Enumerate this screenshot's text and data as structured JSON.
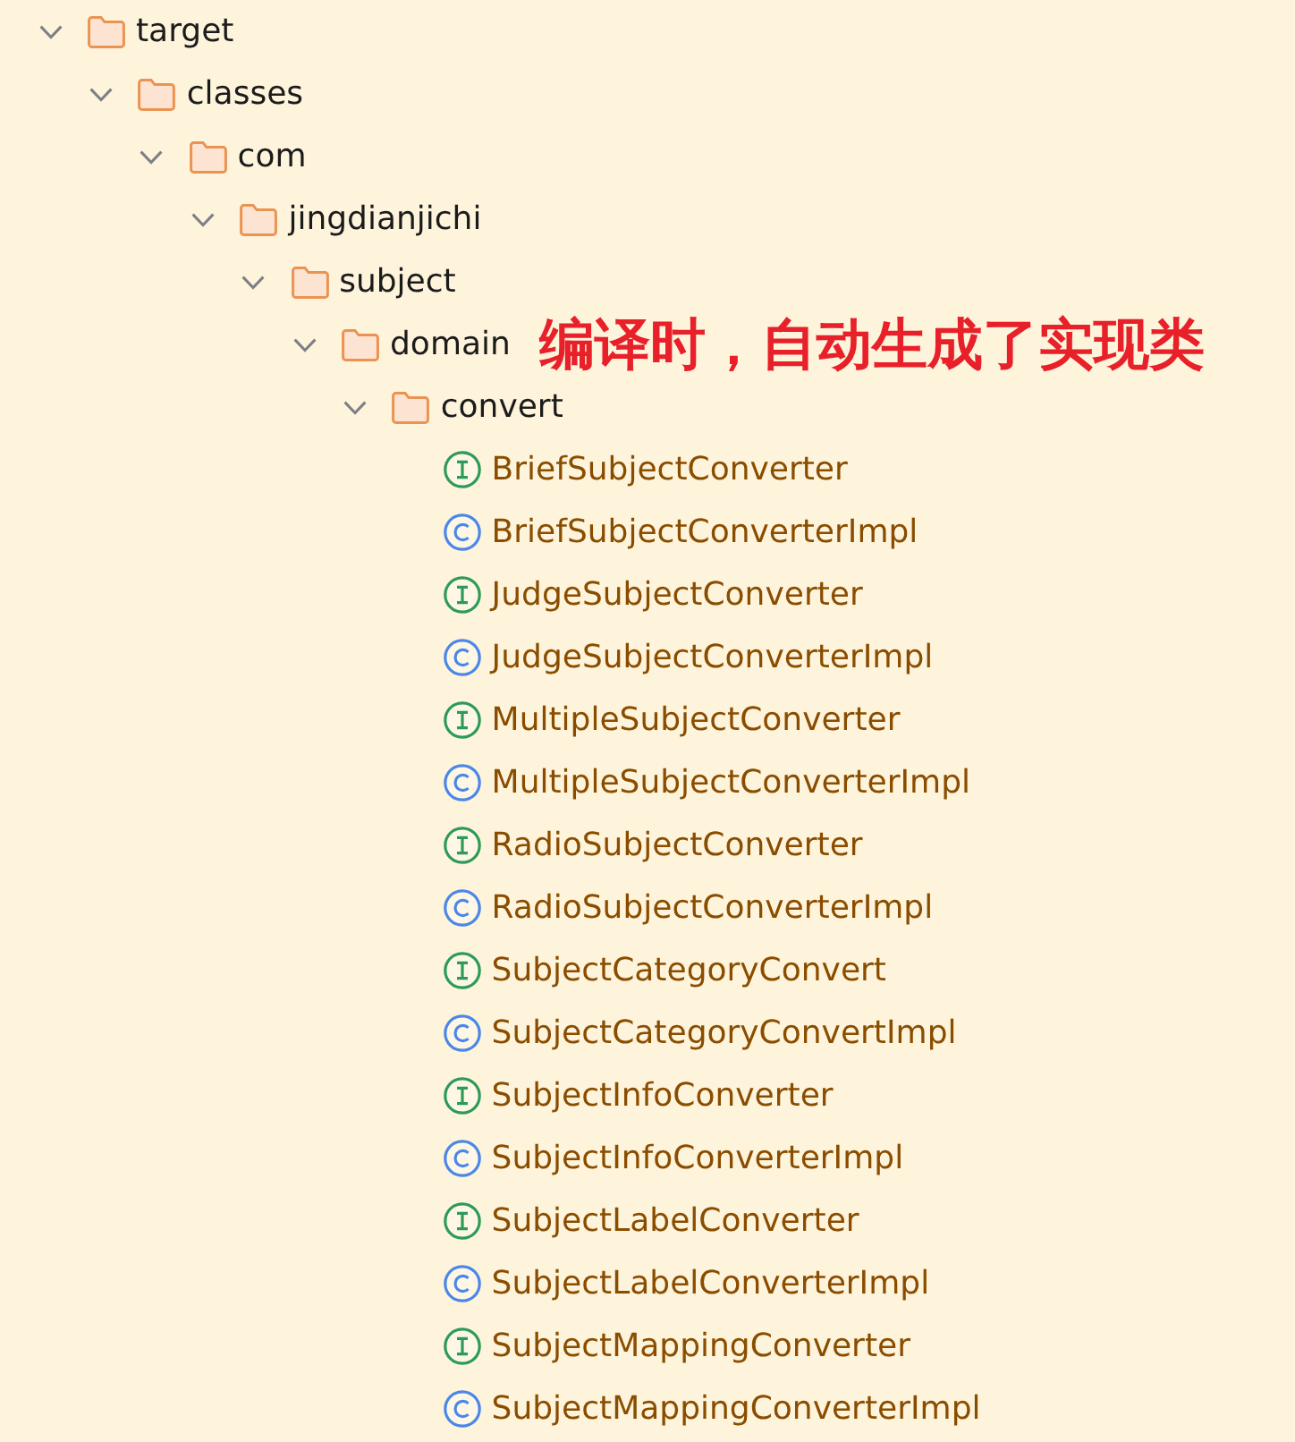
{
  "tree": [
    {
      "kind": "folder",
      "name": "target",
      "expanded": true,
      "children": [
        {
          "kind": "folder",
          "name": "classes",
          "expanded": true,
          "children": [
            {
              "kind": "folder",
              "name": "com",
              "expanded": true,
              "children": [
                {
                  "kind": "folder",
                  "name": "jingdianjichi",
                  "expanded": true,
                  "children": [
                    {
                      "kind": "folder",
                      "name": "subject",
                      "expanded": true,
                      "children": [
                        {
                          "kind": "folder",
                          "name": "domain",
                          "expanded": true,
                          "annotation": "编译时，自动生成了实现类",
                          "children": [
                            {
                              "kind": "folder",
                              "name": "convert",
                              "expanded": true,
                              "children": [
                                {
                                  "kind": "interface",
                                  "name": "BriefSubjectConverter"
                                },
                                {
                                  "kind": "class",
                                  "name": "BriefSubjectConverterImpl"
                                },
                                {
                                  "kind": "interface",
                                  "name": "JudgeSubjectConverter"
                                },
                                {
                                  "kind": "class",
                                  "name": "JudgeSubjectConverterImpl"
                                },
                                {
                                  "kind": "interface",
                                  "name": "MultipleSubjectConverter"
                                },
                                {
                                  "kind": "class",
                                  "name": "MultipleSubjectConverterImpl"
                                },
                                {
                                  "kind": "interface",
                                  "name": "RadioSubjectConverter"
                                },
                                {
                                  "kind": "class",
                                  "name": "RadioSubjectConverterImpl"
                                },
                                {
                                  "kind": "interface",
                                  "name": "SubjectCategoryConvert"
                                },
                                {
                                  "kind": "class",
                                  "name": "SubjectCategoryConvertImpl"
                                },
                                {
                                  "kind": "interface",
                                  "name": "SubjectInfoConverter"
                                },
                                {
                                  "kind": "class",
                                  "name": "SubjectInfoConverterImpl"
                                },
                                {
                                  "kind": "interface",
                                  "name": "SubjectLabelConverter"
                                },
                                {
                                  "kind": "class",
                                  "name": "SubjectLabelConverterImpl"
                                },
                                {
                                  "kind": "interface",
                                  "name": "SubjectMappingConverter"
                                },
                                {
                                  "kind": "class",
                                  "name": "SubjectMappingConverterImpl"
                                }
                              ]
                            }
                          ]
                        }
                      ]
                    }
                  ]
                }
              ]
            }
          ]
        }
      ]
    }
  ]
}
